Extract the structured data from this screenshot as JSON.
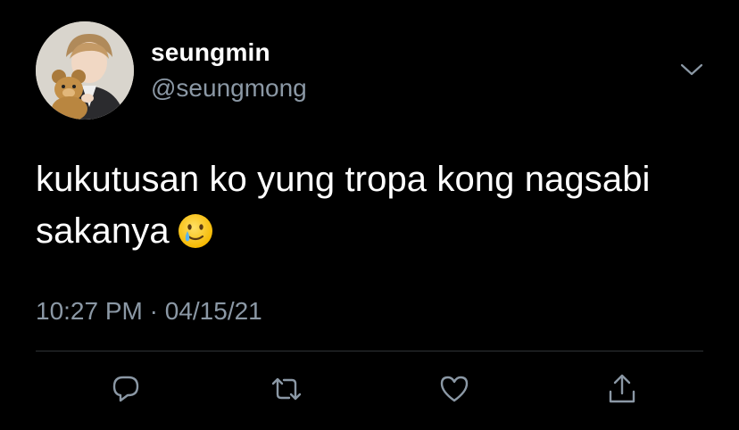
{
  "user": {
    "display_name": "seungmin",
    "handle": "@seungmong",
    "avatar": "profile-photo"
  },
  "tweet": {
    "text": "kukutusan ko yung tropa kong nagsabi sakanya",
    "emoji": "smiling-face-with-tear-emoji",
    "time": "10:27 PM",
    "separator": "·",
    "date": "04/15/21"
  },
  "actions": {
    "reply": "reply-icon",
    "retweet": "retweet-icon",
    "like": "heart-icon",
    "share": "share-icon",
    "menu": "chevron-down-icon"
  },
  "colors": {
    "background": "#000000",
    "text": "#ffffff",
    "secondary_text": "#8b98a5",
    "divider": "#2f3336"
  }
}
